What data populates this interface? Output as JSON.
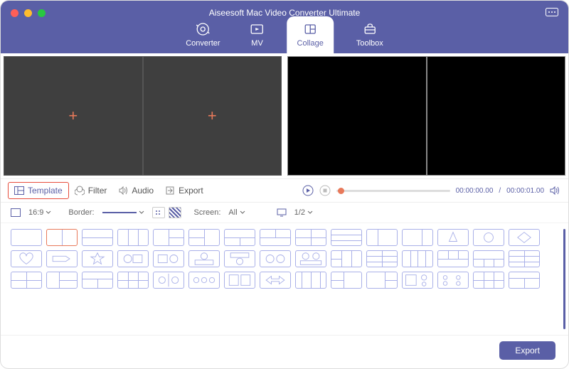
{
  "app_title": "Aiseesoft Mac Video Converter Ultimate",
  "nav": {
    "converter": "Converter",
    "mv": "MV",
    "collage": "Collage",
    "toolbox": "Toolbox"
  },
  "tabs": {
    "template": "Template",
    "filter": "Filter",
    "audio": "Audio",
    "export": "Export"
  },
  "playback": {
    "current": "00:00:00.00",
    "divider": "/",
    "total": "00:00:01.00"
  },
  "options": {
    "aspect_label": "16:9",
    "border_label": "Border:",
    "screen_label": "Screen:",
    "screen_value": "All",
    "page_value": "1/2"
  },
  "footer": {
    "export": "Export"
  },
  "colors": {
    "accent": "#5a5fa6",
    "highlight": "#e8795a"
  }
}
